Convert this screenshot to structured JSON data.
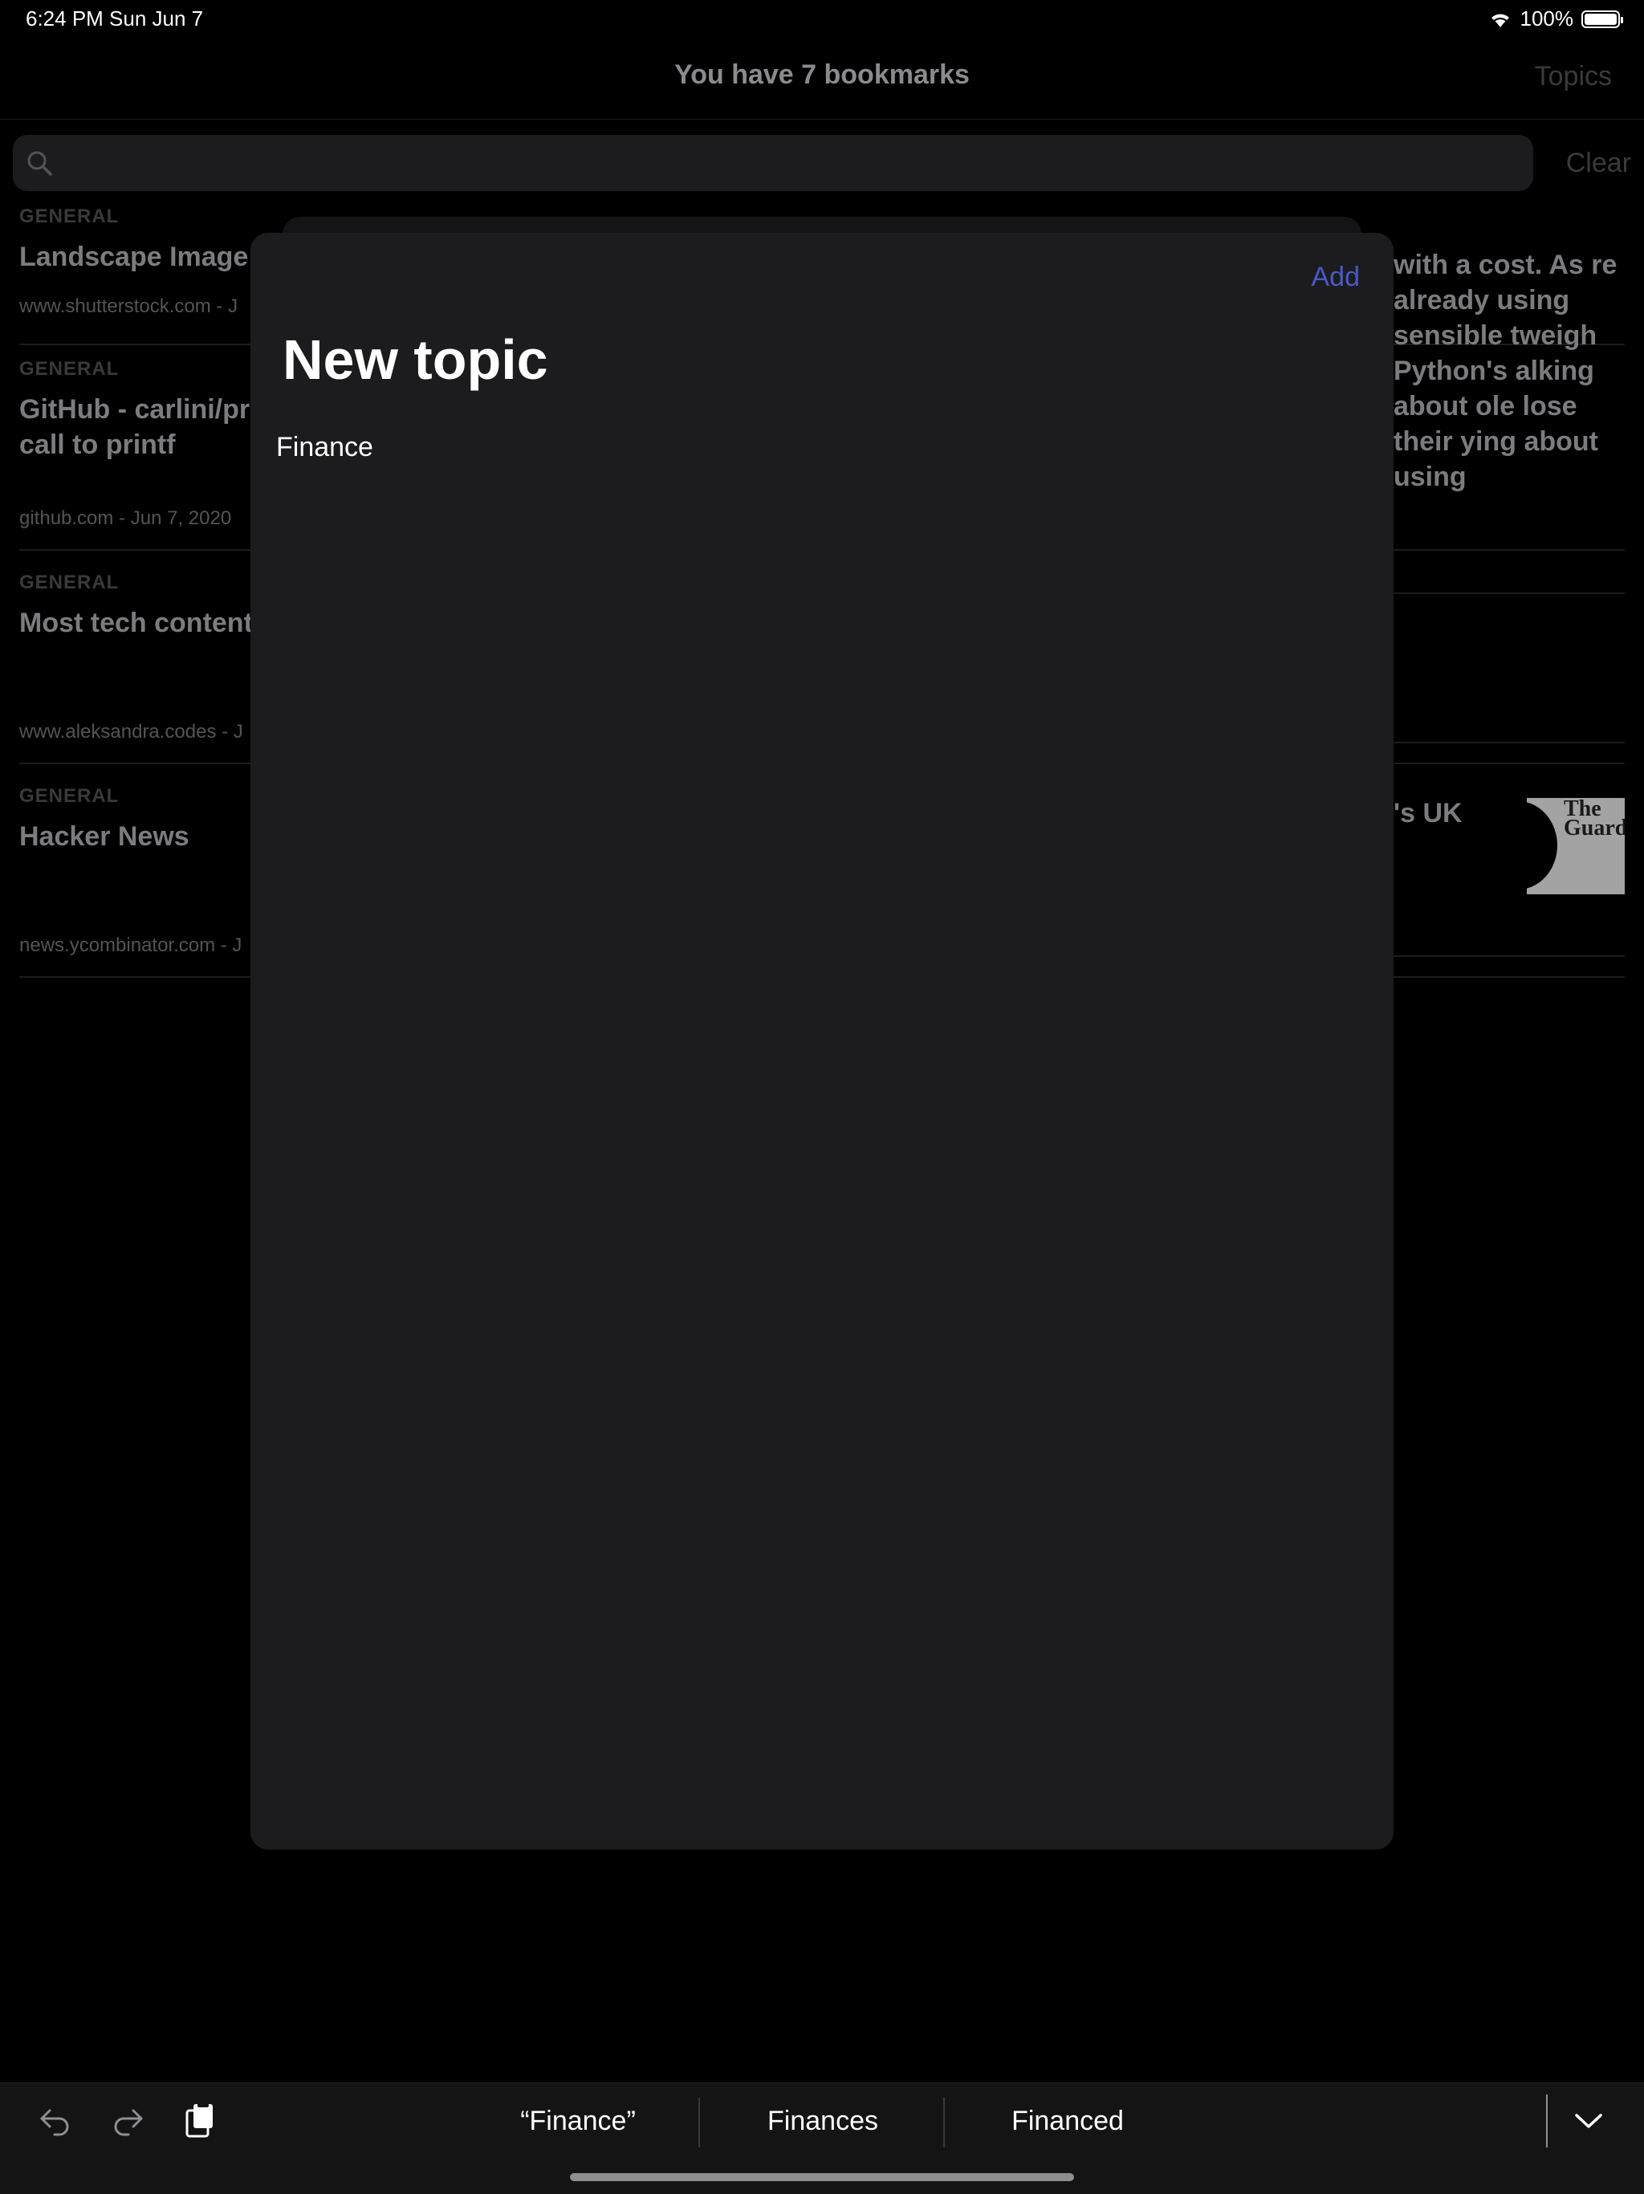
{
  "status": {
    "time_date": "6:24 PM   Sun Jun 7",
    "battery": "100%"
  },
  "nav": {
    "title": "You have 7 bookmarks",
    "topics_label": "Topics"
  },
  "search": {
    "placeholder": "",
    "clear_label": "Clear"
  },
  "bookmarks": [
    {
      "category": "GENERAL",
      "title": "Landscape Image",
      "meta": "www.shutterstock.com - J"
    },
    {
      "category": "GENERAL",
      "title": "GitHub - carlini/pr call to printf",
      "meta": "github.com - Jun 7, 2020"
    },
    {
      "category": "GENERAL",
      "title": "Most tech content",
      "meta": "www.aleksandra.codes - J"
    },
    {
      "category": "GENERAL",
      "title": "Hacker News",
      "meta": "news.ycombinator.com - J"
    }
  ],
  "right_column": {
    "excerpt": "with a cost. As re already using sensible tweigh Python's alking about ole lose their ying about using",
    "uk_title": "'s UK",
    "thumb_text": "The Guard"
  },
  "sheet": {
    "add_label": "Add",
    "title": "New topic",
    "input_value": "Finance"
  },
  "keyboard": {
    "suggestions": [
      "“Finance”",
      "Finances",
      "Financed"
    ]
  }
}
